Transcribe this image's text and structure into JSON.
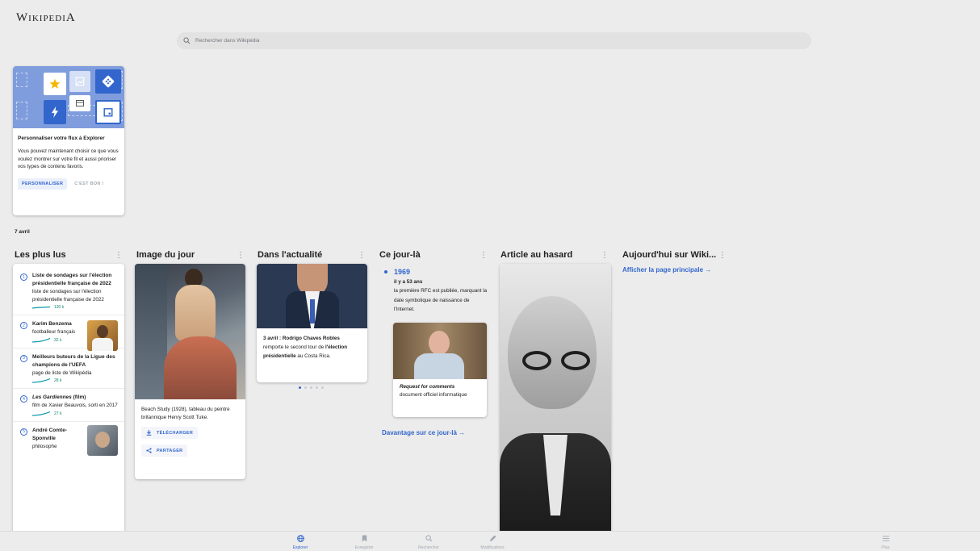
{
  "header": {
    "logo": "Wikipedia",
    "logo_first": "W",
    "logo_rest": "IKIPEDI",
    "logo_last": "A",
    "search_placeholder": "Rechercher dans Wikipédia"
  },
  "promo": {
    "title": "Personnaliser votre flux à Explorer",
    "body": "Vous pouvez maintenant choisir ce que vous voulez montrer sur votre fil et aussi prioriser vos types de contenu favoris.",
    "primary": "PERSONNALISER",
    "secondary": "C'EST BON !"
  },
  "date": "7 avril",
  "columns": {
    "most_read": "Les plus lus",
    "potd": "Image du jour",
    "news": "Dans l'actualité",
    "otd": "Ce jour-là",
    "random": "Article au hasard",
    "today": "Aujourd'hui sur Wiki..."
  },
  "most_read": [
    {
      "num": "1",
      "title": "Liste de sondages sur l'élection présidentielle française de 2022",
      "desc": "liste de sondages sur l'élection présidentielle française de 2022",
      "views": "130 k",
      "italic": false
    },
    {
      "num": "2",
      "title": "Karim Benzema",
      "desc": "footballeur français",
      "views": "32 k",
      "italic": false
    },
    {
      "num": "3",
      "title": "Meilleurs buteurs de la Ligue des champions de l'UEFA",
      "desc": "page de liste de Wikipédia",
      "views": "28 k",
      "italic": false
    },
    {
      "num": "4",
      "title_italic": "Les Gardiennes",
      "title_rest": " (film)",
      "desc": "film de Xavier Beauvois, sorti en 2017",
      "views": "27 k"
    },
    {
      "num": "5",
      "title": "André Comte-Sponville",
      "desc": "philosophe"
    }
  ],
  "potd": {
    "caption": "Beach Study (1928), tableau du peintre britannique Henry Scott Tuke.",
    "download": "TÉLÉCHARGER",
    "share": "PARTAGER"
  },
  "news": {
    "date_prefix": "3 avril : ",
    "headline_bold": "Rodrigo Chaves Robles",
    "text_1": " remporte le second tour de ",
    "bold_2": "l'élection présidentielle",
    "text_2": " au Costa Rica."
  },
  "otd": {
    "year": "1969",
    "ago": "il y a 53 ans",
    "desc": "la première RFC est publiée, marquant la date symbolique de naissance de l'Internet.",
    "card_title": "Request for comments",
    "card_desc": "document officiel informatique",
    "more": "Davantage sur ce jour-là →"
  },
  "today": {
    "link": "Afficher la page principale →"
  },
  "bottom_nav": {
    "explore": "Explorer",
    "saved": "Enregistré",
    "search": "Rechercher",
    "edits": "Modifications",
    "more": "Plus"
  },
  "colors": {
    "accent": "#3366cc",
    "views": "#14866d",
    "trend_line": "#0e9bad"
  }
}
